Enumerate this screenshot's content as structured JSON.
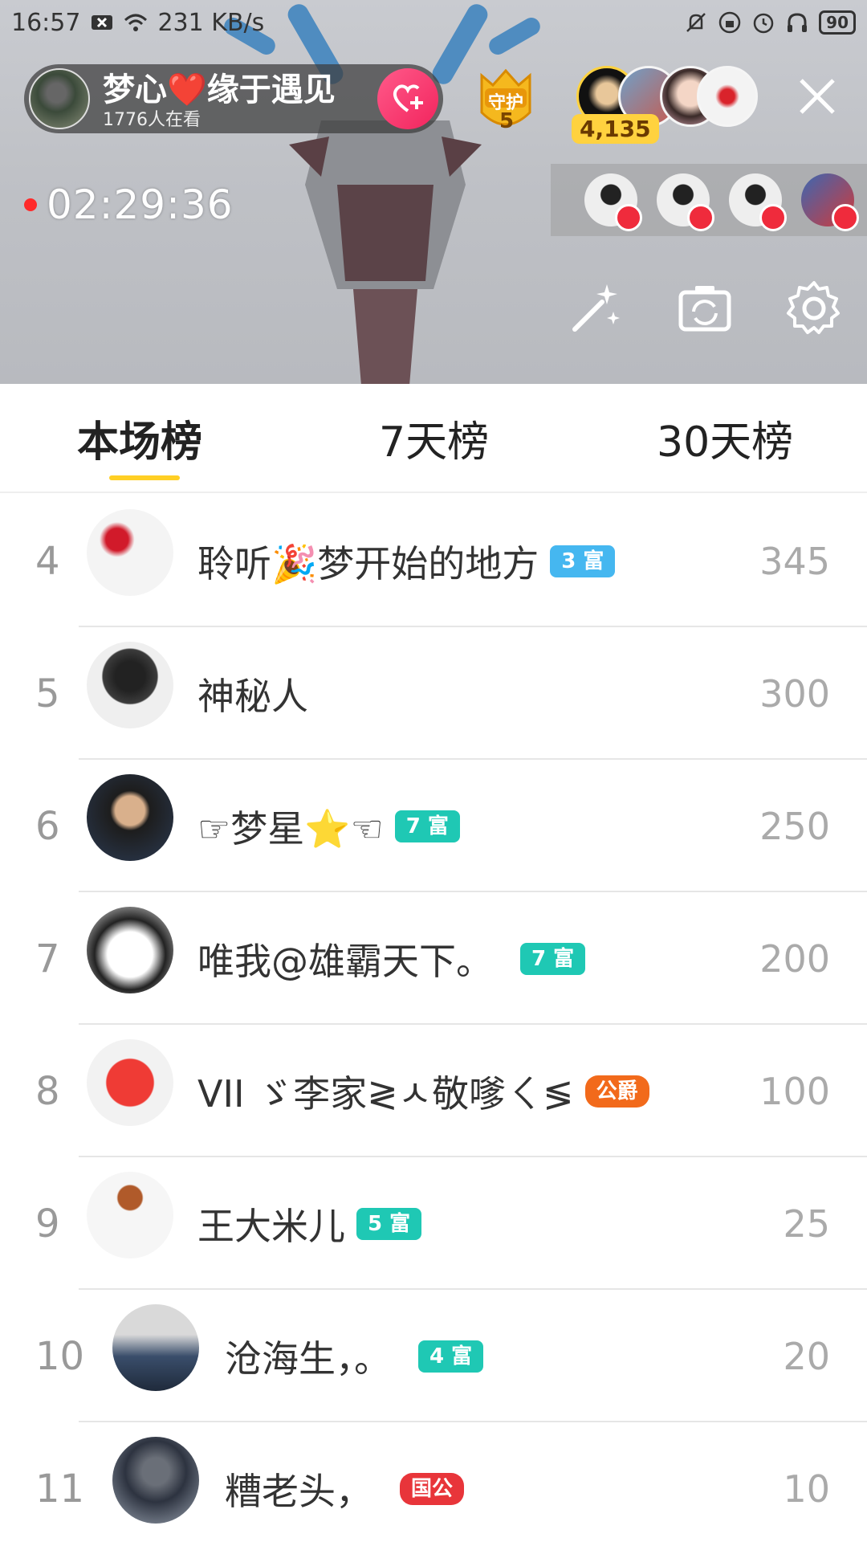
{
  "status_bar": {
    "time": "16:57",
    "speed": "231 KB/s",
    "battery": "90"
  },
  "live": {
    "anchor_name": "梦心❤️缘于遇见",
    "viewers": "1776人在看",
    "guard": {
      "label": "守护",
      "count": "5"
    },
    "coin_count": "4,135",
    "timer": "02:29:36"
  },
  "tabs": [
    "本场榜",
    "7天榜",
    "30天榜"
  ],
  "ranking": [
    {
      "rank": "4",
      "name": "聆听🎉梦开始的地方",
      "badge": "3 富",
      "score": "345"
    },
    {
      "rank": "5",
      "name": "神秘人",
      "badge": "",
      "score": "300"
    },
    {
      "rank": "6",
      "name": "☞梦星⭐☜",
      "badge": "7 富",
      "score": "250"
    },
    {
      "rank": "7",
      "name": "唯我@雄霸天下。",
      "badge": "7 富",
      "score": "200"
    },
    {
      "rank": "8",
      "name": "VII ゞ李家≷ㅅ敬嗲ㄑ≶",
      "badge": "公爵",
      "score": "100"
    },
    {
      "rank": "9",
      "name": "王大米儿",
      "badge": "5 富",
      "score": "25"
    },
    {
      "rank": "10",
      "name": "沧海生，。",
      "badge": "4 富",
      "score": "20"
    },
    {
      "rank": "11",
      "name": "糟老头，",
      "badge": "国公",
      "score": "10"
    }
  ],
  "colors": {
    "tab_underline": "#ffcf24",
    "badge_blue": "#45b7f0",
    "badge_teal": "#1fc8b4",
    "badge_orange": "#f26a1b",
    "badge_red": "#e8353a"
  }
}
